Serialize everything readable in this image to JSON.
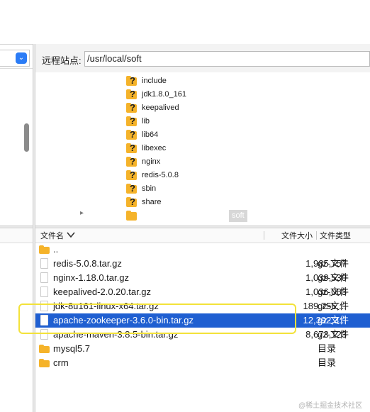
{
  "remote": {
    "label": "远程站点:",
    "path": "/usr/local/soft",
    "tree": [
      {
        "name": "include"
      },
      {
        "name": "jdk1.8.0_161"
      },
      {
        "name": "keepalived"
      },
      {
        "name": "lib"
      },
      {
        "name": "lib64"
      },
      {
        "name": "libexec"
      },
      {
        "name": "nginx"
      },
      {
        "name": "redis-5.0.8"
      },
      {
        "name": "sbin"
      },
      {
        "name": "share"
      },
      {
        "name": "soft"
      }
    ]
  },
  "list": {
    "headers": {
      "name": "文件名",
      "size": "文件大小",
      "type": "文件类型"
    },
    "rows": [
      {
        "name": "..",
        "size": "",
        "type": "",
        "kind": "folder"
      },
      {
        "name": "redis-5.0.8.tar.gz",
        "size": "1,985,757",
        "type": "gz-文件",
        "kind": "file"
      },
      {
        "name": "nginx-1.18.0.tar.gz",
        "size": "1,039,530",
        "type": "gz-文件",
        "kind": "file"
      },
      {
        "name": "keepalived-2.0.20.tar.gz",
        "size": "1,036,063",
        "type": "gz-文件",
        "kind": "file"
      },
      {
        "name": "jdk-8u161-linux-x64.tar.gz",
        "size": "189,756,...",
        "type": "gz-文件",
        "kind": "file"
      },
      {
        "name": "apache-zookeeper-3.6.0-bin.tar.gz",
        "size": "12,392,3...",
        "type": "gz-文件",
        "kind": "file",
        "selected": true
      },
      {
        "name": "apache-maven-3.8.5-bin.tar.gz",
        "size": "8,673,123",
        "type": "gz-文件",
        "kind": "file"
      },
      {
        "name": "mysql5.7",
        "size": "",
        "type": "目录",
        "kind": "folder"
      },
      {
        "name": "crm",
        "size": "",
        "type": "目录",
        "kind": "folder"
      }
    ]
  },
  "watermark": "@稀土掘金技术社区",
  "colors": {
    "selection": "#1f5fd1",
    "folder": "#f5b32a",
    "highlight": "#f3e23a",
    "dropdown": "#2b7cf6"
  }
}
